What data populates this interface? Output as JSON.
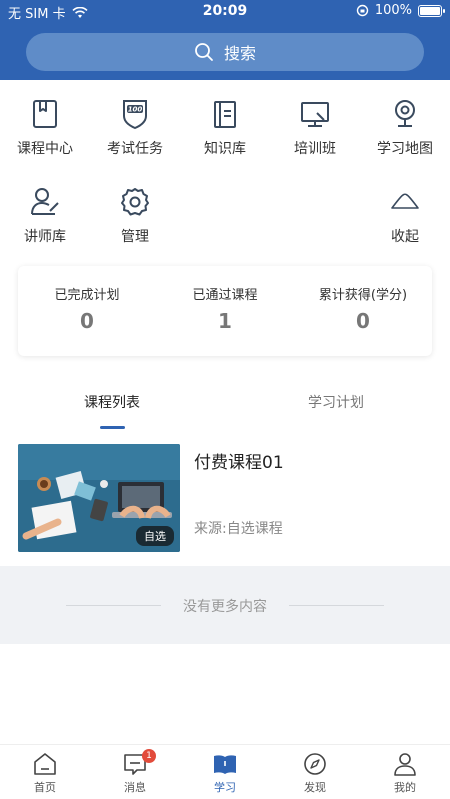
{
  "status_bar": {
    "carrier": "无 SIM 卡",
    "time": "20:09",
    "battery": "100%",
    "battery_level": 1.0
  },
  "search": {
    "label": "搜索"
  },
  "menu": [
    {
      "label": "课程中心",
      "icon": "book-icon"
    },
    {
      "label": "考试任务",
      "icon": "exam-shield-icon"
    },
    {
      "label": "知识库",
      "icon": "knowledge-doc-icon"
    },
    {
      "label": "培训班",
      "icon": "training-monitor-icon"
    },
    {
      "label": "学习地图",
      "icon": "map-pin-icon"
    },
    {
      "label": "讲师库",
      "icon": "lecturer-icon"
    },
    {
      "label": "管理",
      "icon": "gear-icon"
    },
    {
      "label": "收起",
      "icon": "chevron-up-icon"
    }
  ],
  "stats": [
    {
      "title": "已完成计划",
      "value": "0"
    },
    {
      "title": "已通过课程",
      "value": "1"
    },
    {
      "title": "累计获得(学分)",
      "value": "0"
    }
  ],
  "tabs": [
    {
      "label": "课程列表",
      "active": true
    },
    {
      "label": "学习计划",
      "active": false
    }
  ],
  "course": {
    "title": "付费课程01",
    "source": "来源:自选课程",
    "badge": "自选"
  },
  "no_more": "没有更多内容",
  "tabbar": [
    {
      "label": "首页",
      "icon": "home-icon"
    },
    {
      "label": "消息",
      "icon": "message-icon",
      "badge": "1"
    },
    {
      "label": "学习",
      "icon": "study-book-icon",
      "active": true
    },
    {
      "label": "发现",
      "icon": "compass-icon"
    },
    {
      "label": "我的",
      "icon": "profile-icon"
    }
  ],
  "colors": {
    "primary": "#2f63b2",
    "search_bg": "#5f8cc8",
    "badge": "#e24b3b"
  }
}
